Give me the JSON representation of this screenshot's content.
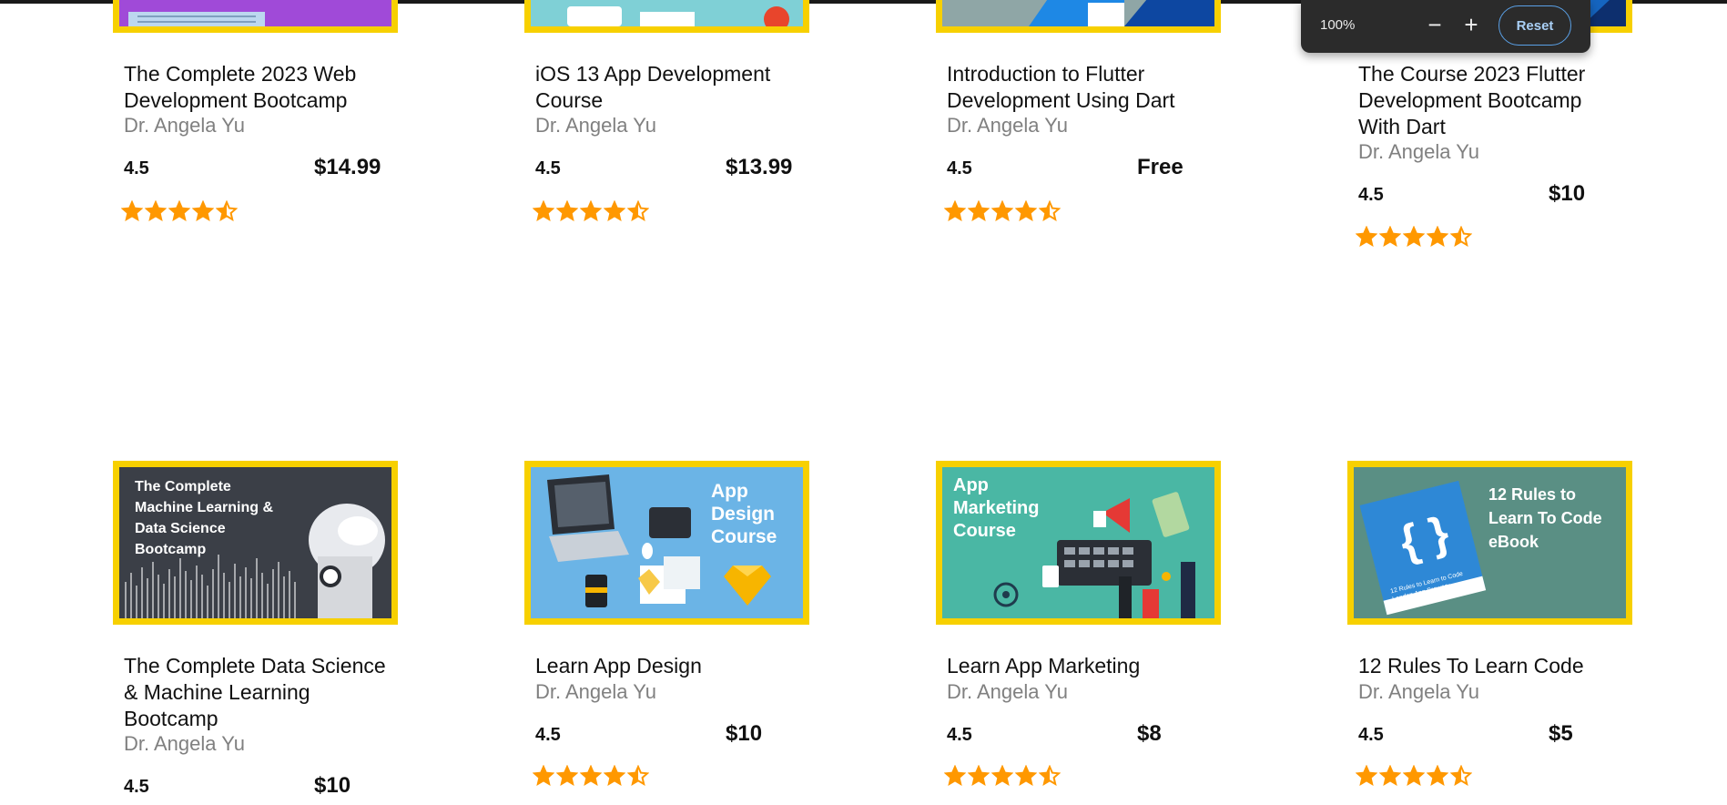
{
  "zoom": {
    "level": "100%",
    "minus": "−",
    "plus": "+",
    "reset_label": "Reset"
  },
  "courses_row1": [
    {
      "title": "The Complete 2023 Web Development Bootcamp",
      "author": "Dr. Angela Yu",
      "rating": "4.5",
      "price": "$14.99",
      "stars": 4.5
    },
    {
      "title": "iOS 13 App Development Course",
      "author": "Dr. Angela Yu",
      "rating": "4.5",
      "price": "$13.99",
      "stars": 4.5
    },
    {
      "title": "Introduction to Flutter Development Using Dart",
      "author": "Dr. Angela Yu",
      "rating": "4.5",
      "price": "Free",
      "stars": 4.5
    },
    {
      "title": "The Course 2023 Flutter Development Bootcamp With Dart",
      "author": "Dr. Angela Yu",
      "rating": "4.5",
      "price": "$10",
      "stars": 4.5
    }
  ],
  "courses_row2": [
    {
      "title": "The Complete Data Science & Machine Learning Bootcamp",
      "author": "Dr. Angela Yu",
      "rating": "4.5",
      "price": "$10",
      "stars": 4.5,
      "thumb_text": [
        "The Complete",
        "Machine Learning &",
        "Data Science",
        "Bootcamp"
      ]
    },
    {
      "title": "Learn App Design",
      "author": "Dr. Angela Yu",
      "rating": "4.5",
      "price": "$10",
      "stars": 4.5,
      "thumb_text": [
        "App",
        "Design",
        "Course"
      ]
    },
    {
      "title": "Learn App Marketing",
      "author": "Dr. Angela Yu",
      "rating": "4.5",
      "price": "$8",
      "stars": 4.5,
      "thumb_text": [
        "App",
        "Marketing",
        "Course"
      ]
    },
    {
      "title": "12 Rules To Learn Code",
      "author": "Dr. Angela Yu",
      "rating": "4.5",
      "price": "$5",
      "stars": 4.5,
      "thumb_text": [
        "12 Rules to",
        "Learn To Code",
        "eBook"
      ],
      "book_text": [
        "12 Rules to Learn to Code",
        "London App Brewery"
      ]
    }
  ],
  "colors": {
    "border": "#f7d000",
    "star": "#ff9800",
    "author": "#808080"
  }
}
